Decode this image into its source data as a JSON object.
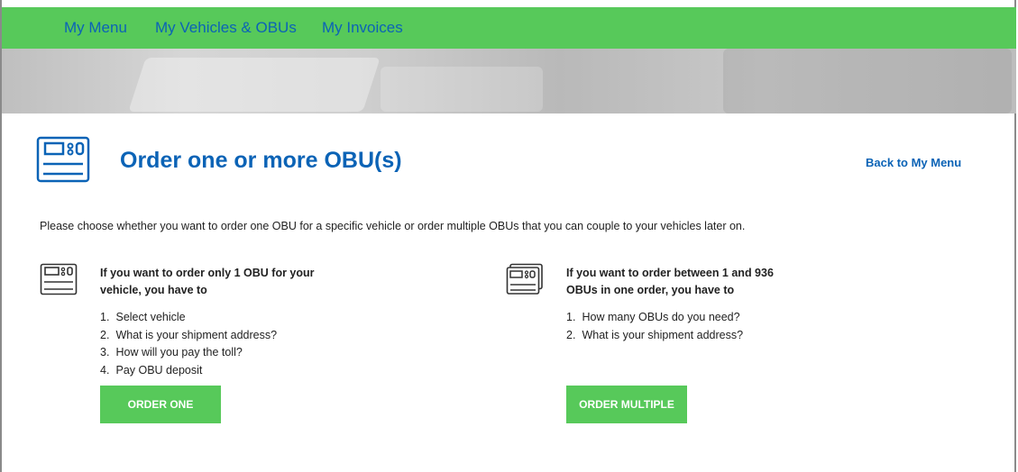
{
  "nav": {
    "items": [
      {
        "label": "My Menu"
      },
      {
        "label": "My Vehicles & OBUs"
      },
      {
        "label": "My Invoices"
      }
    ]
  },
  "page": {
    "title": "Order one or more OBU(s)",
    "back_link": "Back to My Menu",
    "intro": "Please choose whether you want to order one OBU for a specific vehicle or order multiple OBUs that you can couple to your vehicles later on."
  },
  "options": {
    "one": {
      "heading": "If you want to order only 1 OBU for your vehicle, you have to",
      "steps": [
        {
          "num": "1.",
          "text": "Select vehicle"
        },
        {
          "num": "2.",
          "text": "What is your shipment address?"
        },
        {
          "num": "3.",
          "text": "How will you pay the toll?"
        },
        {
          "num": "4.",
          "text": "Pay OBU deposit"
        }
      ],
      "button": "ORDER ONE"
    },
    "multiple": {
      "heading": "If you want to order between 1 and 936 OBUs in one order, you have to",
      "steps": [
        {
          "num": "1.",
          "text": "How many OBUs do you need?"
        },
        {
          "num": "2.",
          "text": "What is your shipment address?"
        }
      ],
      "button": "ORDER MULTIPLE"
    }
  },
  "colors": {
    "accent_green": "#57c95a",
    "link_blue": "#0b63b6"
  },
  "icons": {
    "header": "obu-device-icon",
    "option_one": "obu-device-icon",
    "option_multiple": "obu-stack-icon"
  }
}
